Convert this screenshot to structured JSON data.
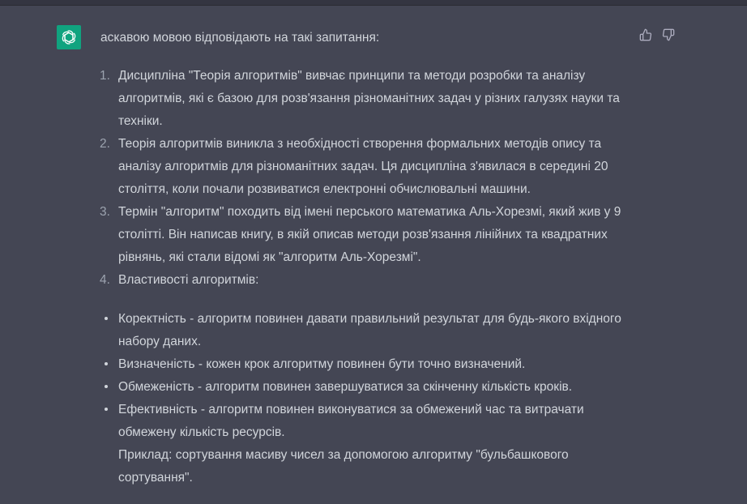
{
  "message": {
    "intro": "аскавою мовою відповідають на такі запитання:",
    "numbered_items": [
      {
        "number": "1.",
        "text": "Дисципліна \"Теорія алгоритмів\" вивчає принципи та методи розробки та аналізу алгоритмів, які є базою для розв'язання різноманітних задач у різних галузях науки та техніки."
      },
      {
        "number": "2.",
        "text": "Теорія алгоритмів виникла з необхідності створення формальних методів опису та аналізу алгоритмів для різноманітних задач. Ця дисципліна з'явилася в середині 20 століття, коли почали розвиватися електронні обчислювальні машини."
      },
      {
        "number": "3.",
        "text": "Термін \"алгоритм\" походить від імені перського математика Аль-Хорезмі, який жив у 9 столітті. Він написав книгу, в якій описав методи розв'язання лінійних та квадратних рівнянь, які стали відомі як \"алгоритм Аль-Хорезмі\"."
      },
      {
        "number": "4.",
        "text": "Властивості алгоритмів:"
      }
    ],
    "bullet_items": [
      "Коректність - алгоритм повинен давати правильний результат для будь-якого вхідного набору даних.",
      "Визначеність - кожен крок алгоритму повинен бути точно визначений.",
      "Обмеженість - алгоритм повинен завершуватися за скінченну кількість кроків.",
      "Ефективність - алгоритм повинен виконуватися за обмежений час та витрачати обмежену кількість ресурсів."
    ],
    "example": "Приклад: сортування масиву чисел за допомогою алгоритму \"бульбашкового сортування\"."
  },
  "icons": {
    "avatar": "openai-logo-icon",
    "thumb_up": "thumbs-up-icon",
    "thumb_down": "thumbs-down-icon"
  },
  "colors": {
    "background": "#444654",
    "top_bar": "#343541",
    "avatar_bg": "#10a37f",
    "text": "#d1d5db",
    "muted": "#9ca3af"
  }
}
